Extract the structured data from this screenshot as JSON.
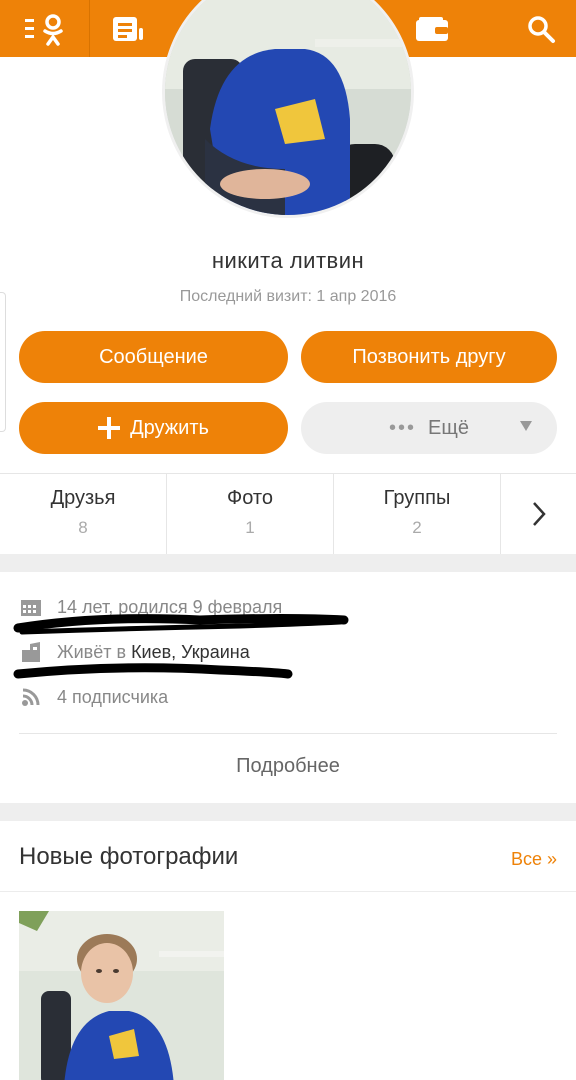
{
  "topbar": {
    "icons": [
      "ok-logo-icon",
      "feed-icon",
      "mail-icon",
      "discussions-icon",
      "friends-icon",
      "wallet-icon",
      "search-icon"
    ],
    "accent": "#ee8208"
  },
  "profile": {
    "name": "никита литвин",
    "last_visit": "Последний визит: 1 апр 2016"
  },
  "actions": {
    "message": "Сообщение",
    "call": "Позвонить другу",
    "add_friend": "Дружить",
    "more": "Ещё",
    "more_dots": "•••"
  },
  "tabs": [
    {
      "label": "Друзья",
      "count": "8"
    },
    {
      "label": "Фото",
      "count": "1"
    },
    {
      "label": "Группы",
      "count": "2"
    }
  ],
  "info": {
    "age": "14 лет, родился 9 февраля",
    "lives_prefix": "Живёт в",
    "lives_city": "Киев, Украина",
    "subscribers": "4 подписчика",
    "more_link": "Подробнее"
  },
  "photos": {
    "title": "Новые фотографии",
    "all_link": "Все »"
  }
}
